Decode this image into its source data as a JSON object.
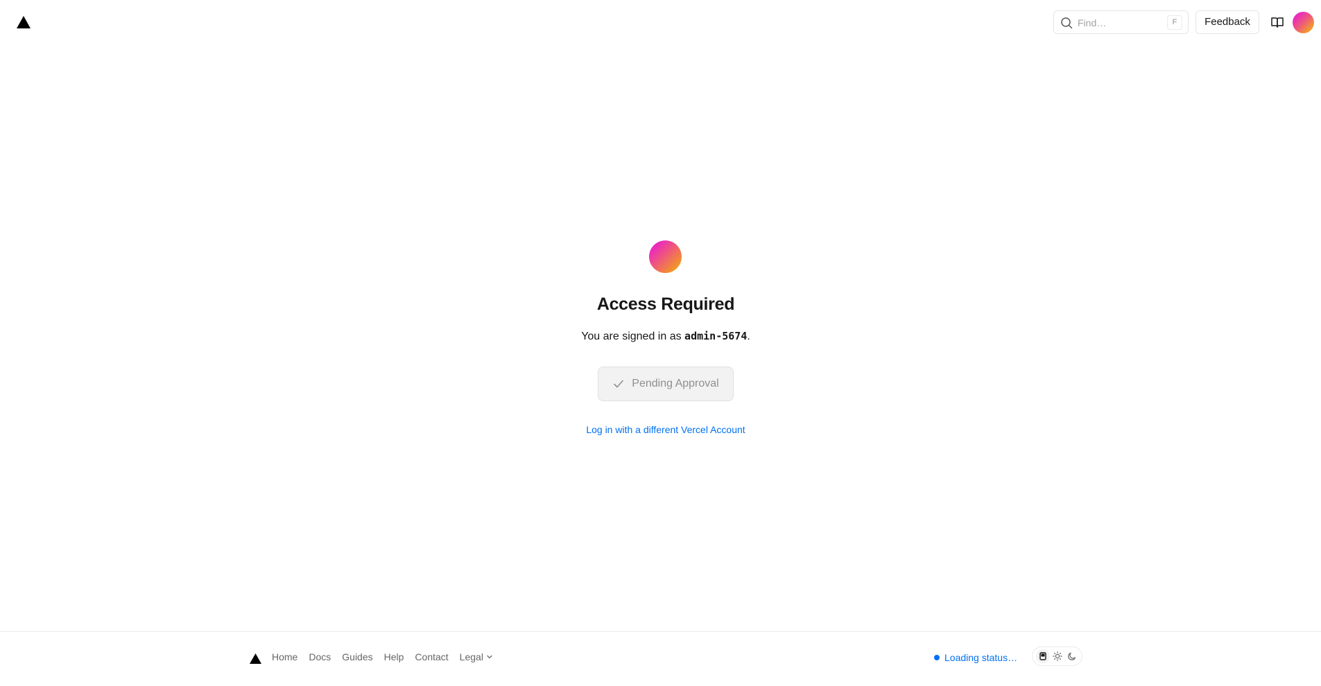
{
  "header": {
    "search_placeholder": "Find…",
    "search_shortcut": "F",
    "feedback_label": "Feedback"
  },
  "main": {
    "title": "Access Required",
    "signed_in_prefix": "You are signed in as ",
    "username": "admin-5674",
    "signed_in_suffix": ".",
    "pending_label": "Pending Approval",
    "alt_login_label": "Log in with a different Vercel Account"
  },
  "footer": {
    "nav": {
      "home": "Home",
      "docs": "Docs",
      "guides": "Guides",
      "help": "Help",
      "contact": "Contact",
      "legal": "Legal"
    },
    "status_label": "Loading status…"
  },
  "icons": {
    "logo": "triangle-logo-icon",
    "search": "search-icon",
    "docs": "book-icon",
    "check": "check-icon",
    "chevron": "chevron-down-icon",
    "theme_system": "monitor-icon",
    "theme_light": "sun-icon",
    "theme_dark": "moon-icon"
  },
  "colors": {
    "link": "#0070f3",
    "avatar_gradient": [
      "#e60ee6",
      "#ee4d8a",
      "#f5b200"
    ]
  }
}
